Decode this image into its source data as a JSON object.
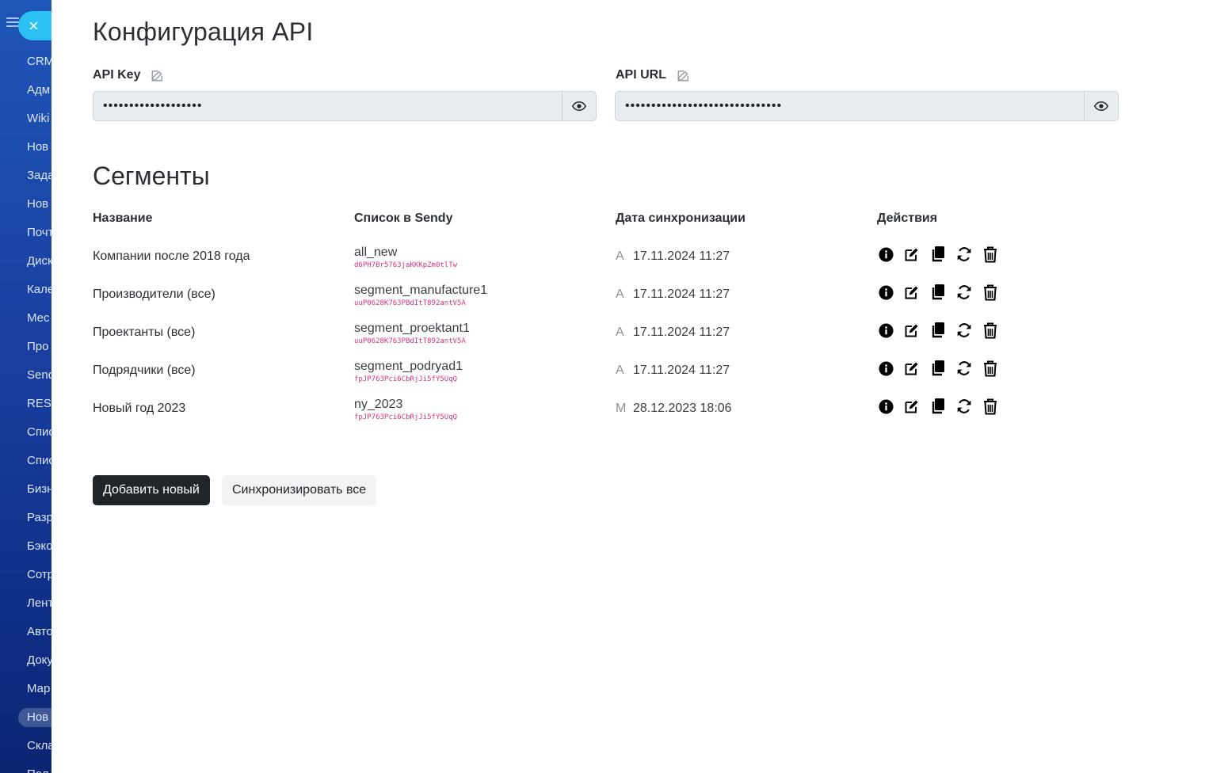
{
  "sidebar": {
    "items": [
      "CRM",
      "Адм",
      "Wiki",
      "Нов",
      "Зада",
      "Нов",
      "Почт",
      "Диск",
      "Кале",
      "Мес",
      "Про",
      "Send",
      "REST",
      "Спис",
      "Спис",
      "Бизн",
      "Разр",
      "Бэко",
      "Сотр",
      "Лент",
      "Авто",
      "Доку",
      "Мар",
      "Нов",
      "Скла",
      "Пол"
    ],
    "active_index": 23,
    "close_symbol": "×"
  },
  "page_title": "Конфигурация API",
  "api_key": {
    "label": "API Key",
    "value": "•••••••••••••••••••"
  },
  "api_url": {
    "label": "API URL",
    "value": "••••••••••••••••••••••••••••••"
  },
  "segments": {
    "title": "Сегменты",
    "headers": {
      "name": "Название",
      "list": "Список в Sendy",
      "date": "Дата синхронизации",
      "actions": "Действия"
    },
    "rows": [
      {
        "name": "Компании после 2018 года",
        "list": "all_new",
        "list_id": "d6PH7Br5763jaKKKpZm0tlTw",
        "mode": "A",
        "date": "17.11.2024 11:27"
      },
      {
        "name": "Производители (все)",
        "list": "segment_manufacture1",
        "list_id": "uuP0628K763PBdItT892antV5A",
        "mode": "A",
        "date": "17.11.2024 11:27"
      },
      {
        "name": "Проектанты (все)",
        "list": "segment_proektant1",
        "list_id": "uuP0628K763PBdItT892antV5A",
        "mode": "A",
        "date": "17.11.2024 11:27"
      },
      {
        "name": "Подрядчики (все)",
        "list": "segment_podryad1",
        "list_id": "fpJP763Pci6CbRjJi5fY5UqQ",
        "mode": "A",
        "date": "17.11.2024 11:27"
      },
      {
        "name": "Новый год 2023",
        "list": "ny_2023",
        "list_id": "fpJP763Pci6CbRjJi5fY5UqQ",
        "mode": "M",
        "date": "28.12.2023 18:06"
      }
    ]
  },
  "buttons": {
    "add_new": "Добавить новый",
    "sync_all": "Синхронизировать все"
  },
  "icons": {
    "row_actions": [
      "info-icon",
      "edit-icon",
      "copy-icon",
      "sync-icon",
      "trash-icon"
    ],
    "field": "edit-icon",
    "reveal": "eye-icon"
  },
  "colors": {
    "accent_cyan": "#2bc1f2",
    "dark_button": "#212529",
    "id_pink": "#d63384"
  }
}
